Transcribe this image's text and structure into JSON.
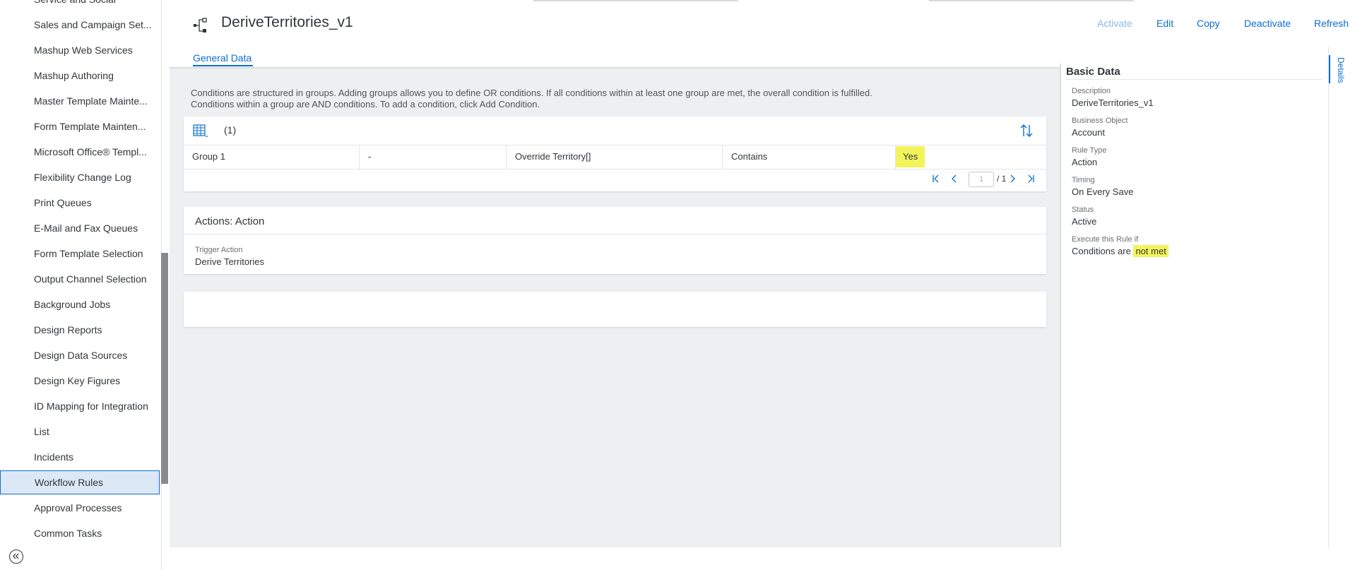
{
  "sidebar": {
    "items": [
      {
        "label": "Service and Social"
      },
      {
        "label": "Sales and Campaign Set..."
      },
      {
        "label": "Mashup Web Services"
      },
      {
        "label": "Mashup Authoring"
      },
      {
        "label": "Master Template Mainte..."
      },
      {
        "label": "Form Template Mainten..."
      },
      {
        "label": "Microsoft Office® Templ..."
      },
      {
        "label": "Flexibility Change Log"
      },
      {
        "label": "Print Queues"
      },
      {
        "label": "E-Mail and Fax Queues"
      },
      {
        "label": "Form Template Selection"
      },
      {
        "label": "Output Channel Selection"
      },
      {
        "label": "Background Jobs"
      },
      {
        "label": "Design Reports"
      },
      {
        "label": "Design Data Sources"
      },
      {
        "label": "Design Key Figures"
      },
      {
        "label": "ID Mapping for Integration"
      },
      {
        "label": "List"
      },
      {
        "label": "Incidents"
      },
      {
        "label": "Workflow Rules",
        "active": true
      },
      {
        "label": "Approval Processes"
      },
      {
        "label": "Common Tasks"
      }
    ]
  },
  "header": {
    "title": "DeriveTerritories_v1",
    "buttons": {
      "activate": "Activate",
      "edit": "Edit",
      "copy": "Copy",
      "deactivate": "Deactivate",
      "refresh": "Refresh"
    },
    "tabs": {
      "general": "General Data"
    }
  },
  "main": {
    "info_line1": "Conditions are structured in groups. Adding groups allows you to define OR conditions. If all conditions within at least one group are met, the overall condition is fulfilled.",
    "info_line2": "Conditions within a group are AND conditions. To add a condition, click Add Condition.",
    "conditions": {
      "count": "(1)",
      "row": {
        "group": "Group 1",
        "operator_dash": "-",
        "field": "Override Territory[]",
        "operator": "Contains",
        "value": "Yes"
      },
      "pager": {
        "current": "1",
        "total": "/ 1"
      }
    },
    "actions": {
      "title": "Actions: Action",
      "trigger_label": "Trigger Action",
      "trigger_value": "Derive Territories"
    }
  },
  "details": {
    "title": "Basic Data",
    "tab_label": "Details",
    "description_label": "Description",
    "description": "DeriveTerritories_v1",
    "business_object_label": "Business Object",
    "business_object": "Account",
    "rule_type_label": "Rule Type",
    "rule_type": "Action",
    "timing_label": "Timing",
    "timing": "On Every Save",
    "status_label": "Status",
    "status": "Active",
    "execute_label": "Execute this Rule if",
    "execute_prefix": "Conditions are",
    "execute_highlight": "not met"
  },
  "colors": {
    "accent": "#0a6ed1",
    "highlight": "#f2f55a",
    "background": "#edeff0"
  }
}
